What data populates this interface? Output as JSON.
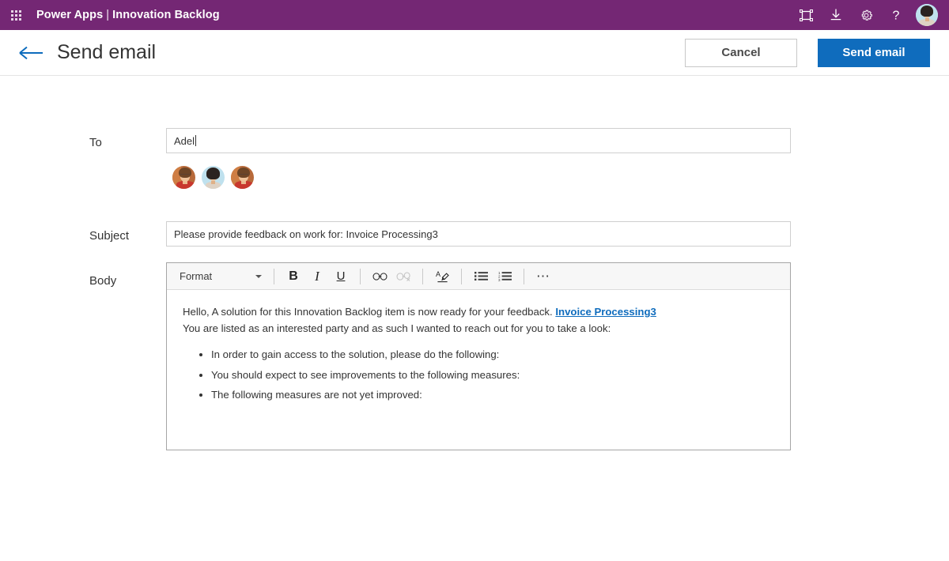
{
  "suite_header": {
    "waffle_icon": "app-launcher-waffle-icon",
    "brand": "Power Apps",
    "separator": "|",
    "app_name": "Innovation Backlog",
    "actions": [
      {
        "name": "fullscreen-icon",
        "label": "Full screen"
      },
      {
        "name": "download-icon",
        "label": "Download"
      },
      {
        "name": "gear-icon",
        "label": "Settings"
      },
      {
        "name": "help-icon",
        "label": "Help"
      }
    ],
    "avatar_name": "user-avatar"
  },
  "command_bar": {
    "back_icon": "back-arrow-icon",
    "title": "Send email",
    "cancel_label": "Cancel",
    "send_label": "Send email"
  },
  "form": {
    "to": {
      "label": "To",
      "value": "Adel",
      "placeholder": ""
    },
    "recipients": [
      {
        "name": "recipient-avatar-1",
        "style": "a"
      },
      {
        "name": "recipient-avatar-2",
        "style": "b"
      },
      {
        "name": "recipient-avatar-3",
        "style": "a"
      }
    ],
    "subject": {
      "label": "Subject",
      "value": "Please provide feedback on work for: Invoice Processing3",
      "placeholder": ""
    },
    "body": {
      "label": "Body",
      "toolbar": {
        "format_label": "Format",
        "bold": "B",
        "italic": "I",
        "underline": "U",
        "link_icon": "insert-link-icon",
        "unlink_icon": "remove-link-icon",
        "clear_format_icon": "clear-formatting-icon",
        "bulleted_list_icon": "bulleted-list-icon",
        "numbered_list_icon": "numbered-list-icon",
        "more_label": "⋯"
      },
      "content": {
        "line1_before_link": "Hello, A solution for this Innovation Backlog item is now ready for your feedback. ",
        "link_text": "Invoice Processing3",
        "line2": "You are listed as an interested party and as such I wanted to reach out for you to take a look:",
        "bullets": [
          "In order to gain access to the solution, please do the following:",
          "You should expect to see improvements to the following measures:",
          "The following measures are not yet improved:"
        ]
      }
    }
  },
  "colors": {
    "suite_purple": "#742774",
    "primary_blue": "#0f6cbd",
    "link_blue": "#0f6cbd",
    "border_gray": "#cfcfcf",
    "toolbar_gray": "#f7f7f7"
  }
}
